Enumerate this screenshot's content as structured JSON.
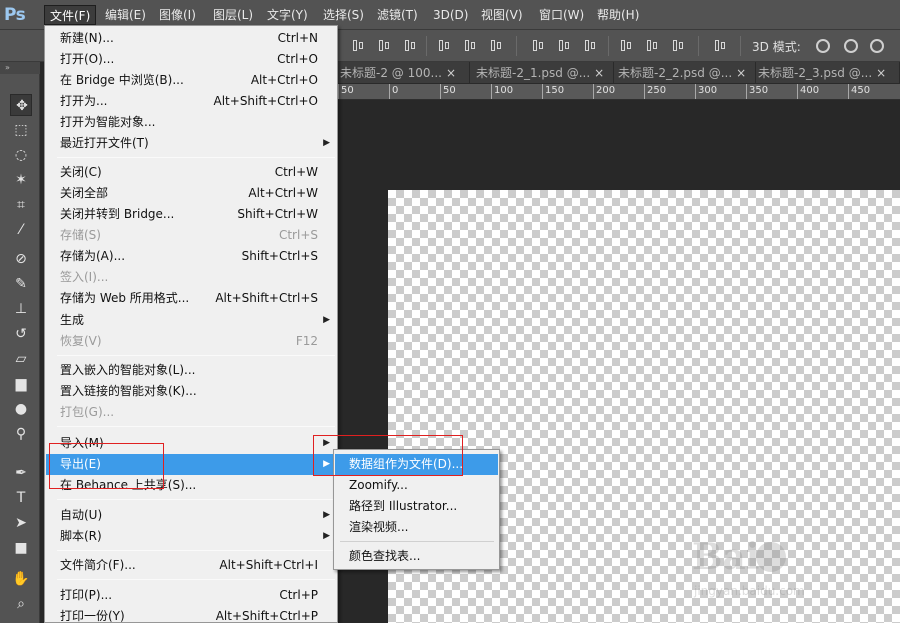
{
  "app": {
    "logo": "Ps"
  },
  "menubar": {
    "items": [
      {
        "label": "文件(F)"
      },
      {
        "label": "编辑(E)"
      },
      {
        "label": "图像(I)"
      },
      {
        "label": "图层(L)"
      },
      {
        "label": "文字(Y)"
      },
      {
        "label": "选择(S)"
      },
      {
        "label": "滤镜(T)"
      },
      {
        "label": "3D(D)"
      },
      {
        "label": "视图(V)"
      },
      {
        "label": "窗口(W)"
      },
      {
        "label": "帮助(H)"
      }
    ]
  },
  "optionsbar": {
    "mode3d_label": "3D 模式:"
  },
  "tabs": [
    {
      "label": "未标题-2 @ 100...",
      "close": "×"
    },
    {
      "label": "未标题-2_1.psd @...",
      "close": "×"
    },
    {
      "label": "未标题-2_2.psd @...",
      "close": "×"
    },
    {
      "label": "未标题-2_3.psd @...",
      "close": "×"
    }
  ],
  "ruler": {
    "labels": [
      "50",
      "0",
      "50",
      "100",
      "150",
      "200",
      "250",
      "300",
      "350",
      "400",
      "450"
    ]
  },
  "sidebar": {
    "collapse": "»"
  },
  "file_menu": {
    "items": [
      {
        "label": "新建(N)...",
        "shortcut": "Ctrl+N"
      },
      {
        "label": "打开(O)...",
        "shortcut": "Ctrl+O"
      },
      {
        "label": "在 Bridge 中浏览(B)...",
        "shortcut": "Alt+Ctrl+O"
      },
      {
        "label": "打开为...",
        "shortcut": "Alt+Shift+Ctrl+O"
      },
      {
        "label": "打开为智能对象..."
      },
      {
        "label": "最近打开文件(T)",
        "submenu": true
      },
      {
        "label": "关闭(C)",
        "shortcut": "Ctrl+W"
      },
      {
        "label": "关闭全部",
        "shortcut": "Alt+Ctrl+W"
      },
      {
        "label": "关闭并转到 Bridge...",
        "shortcut": "Shift+Ctrl+W"
      },
      {
        "label": "存储(S)",
        "shortcut": "Ctrl+S",
        "disabled": true
      },
      {
        "label": "存储为(A)...",
        "shortcut": "Shift+Ctrl+S"
      },
      {
        "label": "签入(I)...",
        "disabled": true
      },
      {
        "label": "存储为 Web 所用格式...",
        "shortcut": "Alt+Shift+Ctrl+S"
      },
      {
        "label": "生成",
        "submenu": true
      },
      {
        "label": "恢复(V)",
        "shortcut": "F12",
        "disabled": true
      },
      {
        "label": "置入嵌入的智能对象(L)..."
      },
      {
        "label": "置入链接的智能对象(K)..."
      },
      {
        "label": "打包(G)...",
        "disabled": true
      },
      {
        "label": "导入(M)",
        "submenu": true
      },
      {
        "label": "导出(E)",
        "submenu": true,
        "highlighted": true
      },
      {
        "label": "在 Behance 上共享(S)..."
      },
      {
        "label": "自动(U)",
        "submenu": true
      },
      {
        "label": "脚本(R)",
        "submenu": true
      },
      {
        "label": "文件简介(F)...",
        "shortcut": "Alt+Shift+Ctrl+I"
      },
      {
        "label": "打印(P)...",
        "shortcut": "Ctrl+P"
      },
      {
        "label": "打印一份(Y)",
        "shortcut": "Alt+Shift+Ctrl+P"
      }
    ]
  },
  "export_submenu": {
    "items": [
      {
        "label": "数据组作为文件(D)...",
        "highlighted": true
      },
      {
        "label": "Zoomify..."
      },
      {
        "label": "路径到 Illustrator..."
      },
      {
        "label": "渲染视频..."
      },
      {
        "label": "颜色查找表..."
      }
    ]
  },
  "watermark": {
    "brand": "Bai",
    "site": "jingyan.baidu.com"
  },
  "colors": {
    "highlight": "#3d9be9",
    "annotation": "#e02020",
    "menubar": "#535353"
  }
}
